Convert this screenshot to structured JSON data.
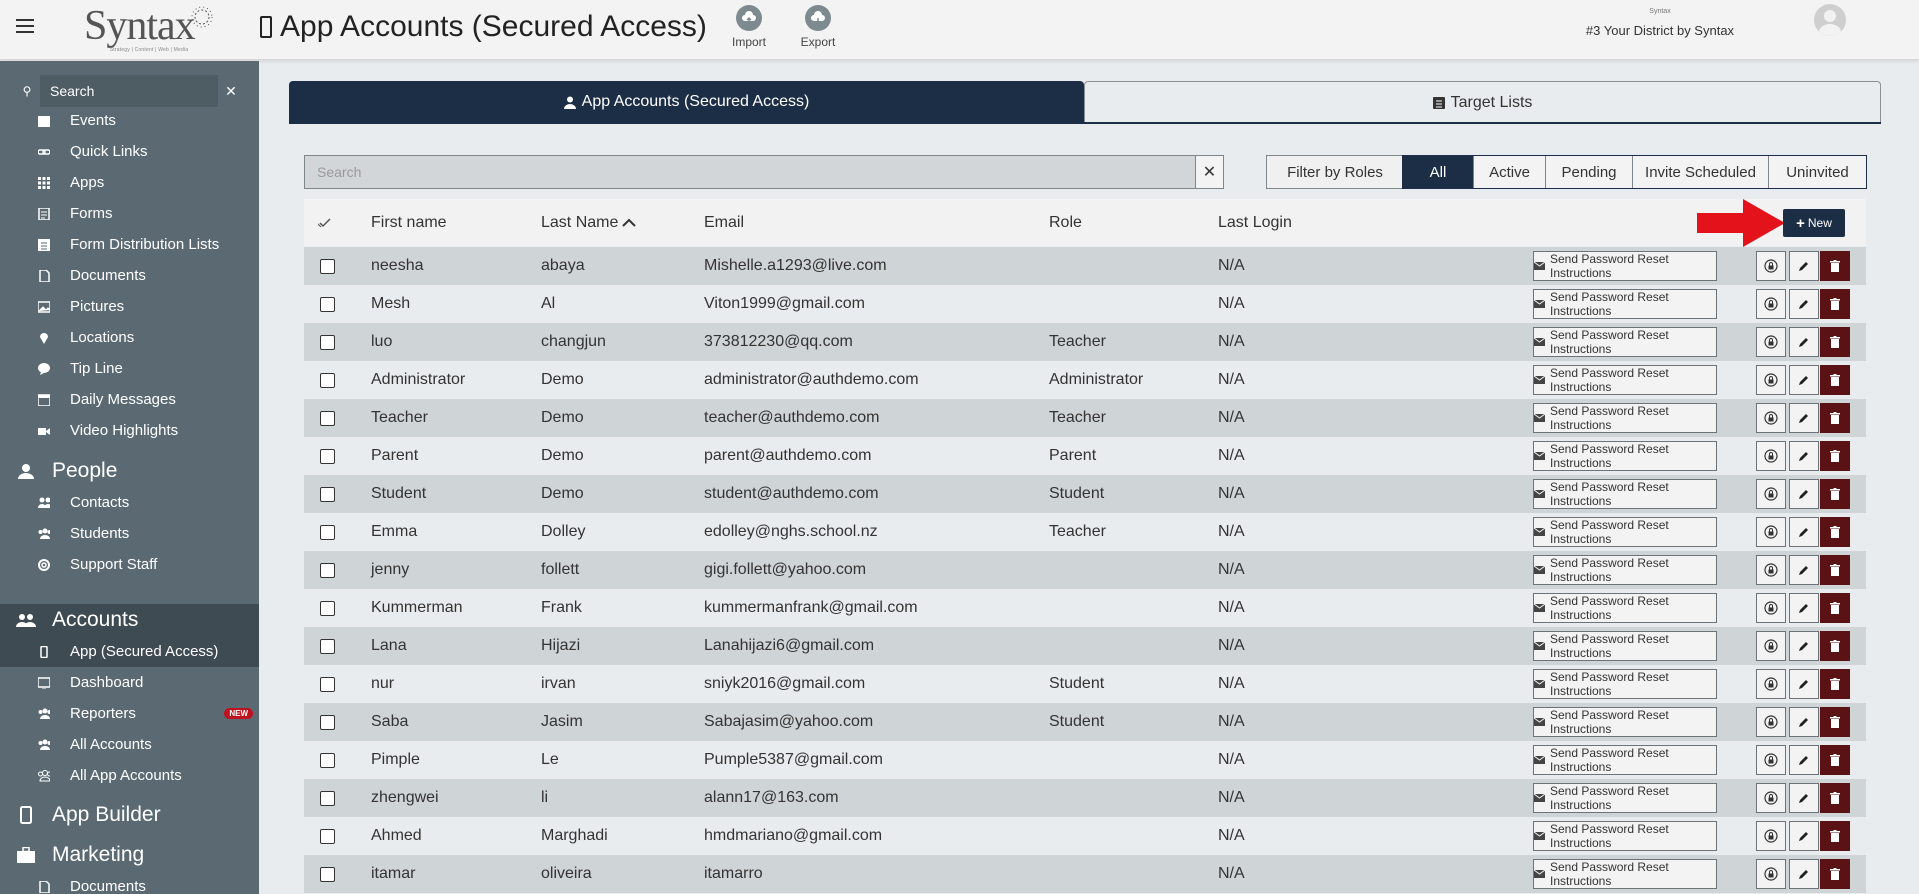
{
  "header": {
    "logo_text": "Syntax",
    "logo_tagline": "Strategy | Content | Web | Media",
    "page_title": "App Accounts (Secured Access)",
    "import_label": "Import",
    "export_label": "Export",
    "district_mini": "Syntax",
    "district_name": "#3 Your District by Syntax"
  },
  "sidebar": {
    "search_placeholder": "Search",
    "items_top": [
      {
        "label": "Events",
        "icon": "calendar-icon"
      },
      {
        "label": "Quick Links",
        "icon": "link-icon"
      },
      {
        "label": "Apps",
        "icon": "grid-icon"
      },
      {
        "label": "Forms",
        "icon": "form-icon"
      },
      {
        "label": "Form Distribution Lists",
        "icon": "list-icon"
      },
      {
        "label": "Documents",
        "icon": "document-icon"
      },
      {
        "label": "Pictures",
        "icon": "picture-icon"
      },
      {
        "label": "Locations",
        "icon": "pin-icon"
      },
      {
        "label": "Tip Line",
        "icon": "chat-icon"
      },
      {
        "label": "Daily Messages",
        "icon": "calendar-icon"
      },
      {
        "label": "Video Highlights",
        "icon": "video-icon"
      }
    ],
    "people": {
      "heading": "People",
      "items": [
        {
          "label": "Contacts",
          "icon": "contacts-icon"
        },
        {
          "label": "Students",
          "icon": "students-icon"
        },
        {
          "label": "Support Staff",
          "icon": "support-icon"
        }
      ]
    },
    "accounts": {
      "heading": "Accounts",
      "items": [
        {
          "label": "App (Secured Access)",
          "icon": "phone-icon"
        },
        {
          "label": "Dashboard",
          "icon": "monitor-icon"
        },
        {
          "label": "Reporters",
          "icon": "reporters-icon",
          "badge": "NEW"
        },
        {
          "label": "All Accounts",
          "icon": "group-icon"
        },
        {
          "label": "All App Accounts",
          "icon": "group-icon"
        }
      ]
    },
    "app_builder": {
      "heading": "App Builder"
    },
    "marketing": {
      "heading": "Marketing",
      "items": [
        {
          "label": "Documents",
          "icon": "document-icon"
        }
      ]
    }
  },
  "tabs": [
    {
      "label": "App Accounts (Secured Access)",
      "icon": "user-icon",
      "active": true
    },
    {
      "label": "Target Lists",
      "icon": "list-icon",
      "active": false
    }
  ],
  "toolbar": {
    "search_placeholder": "Search",
    "filter_label": "Filter by Roles",
    "segments": [
      {
        "label": "All",
        "active": true
      },
      {
        "label": "Active",
        "active": false
      },
      {
        "label": "Pending",
        "active": false
      },
      {
        "label": "Invite Scheduled",
        "active": false
      },
      {
        "label": "Uninvited",
        "active": false
      }
    ],
    "new_label": "New"
  },
  "table": {
    "headers": {
      "first_name": "First name",
      "last_name": "Last Name",
      "email": "Email",
      "role": "Role",
      "last_login": "Last Login"
    },
    "action_label": "Send Password Reset Instructions",
    "rows": [
      {
        "first": "neesha",
        "last": "abaya",
        "email": "Mishelle.a1293@live.com",
        "role": "",
        "login": "N/A"
      },
      {
        "first": "Mesh",
        "last": "Al",
        "email": "Viton1999@gmail.com",
        "role": "",
        "login": "N/A"
      },
      {
        "first": "luo",
        "last": "changjun",
        "email": "373812230@qq.com",
        "role": "Teacher",
        "login": "N/A"
      },
      {
        "first": "Administrator",
        "last": "Demo",
        "email": "administrator@authdemo.com",
        "role": "Administrator",
        "login": "N/A"
      },
      {
        "first": "Teacher",
        "last": "Demo",
        "email": "teacher@authdemo.com",
        "role": "Teacher",
        "login": "N/A"
      },
      {
        "first": "Parent",
        "last": "Demo",
        "email": "parent@authdemo.com",
        "role": "Parent",
        "login": "N/A"
      },
      {
        "first": "Student",
        "last": "Demo",
        "email": "student@authdemo.com",
        "role": "Student",
        "login": "N/A"
      },
      {
        "first": "Emma",
        "last": "Dolley",
        "email": "edolley@nghs.school.nz",
        "role": "Teacher",
        "login": "N/A"
      },
      {
        "first": "jenny",
        "last": "follett",
        "email": "gigi.follett@yahoo.com",
        "role": "",
        "login": "N/A"
      },
      {
        "first": "Kummerman",
        "last": "Frank",
        "email": "kummermanfrank@gmail.com",
        "role": "",
        "login": "N/A"
      },
      {
        "first": "Lana",
        "last": "Hijazi",
        "email": "Lanahijazi6@gmail.com",
        "role": "",
        "login": "N/A"
      },
      {
        "first": "nur",
        "last": "irvan",
        "email": "sniyk2016@gmail.com",
        "role": "Student",
        "login": "N/A"
      },
      {
        "first": "Saba",
        "last": "Jasim",
        "email": "Sabajasim@yahoo.com",
        "role": "Student",
        "login": "N/A"
      },
      {
        "first": "Pimple",
        "last": "Le",
        "email": "Pumple5387@gmail.com",
        "role": "",
        "login": "N/A"
      },
      {
        "first": "zhengwei",
        "last": "li",
        "email": "alann17@163.com",
        "role": "",
        "login": "N/A"
      },
      {
        "first": "Ahmed",
        "last": "Marghadi",
        "email": "hmdmariano@gmail.com",
        "role": "",
        "login": "N/A"
      },
      {
        "first": "itamar",
        "last": "oliveira",
        "email": "itamarro",
        "role": "",
        "login": "N/A"
      }
    ]
  },
  "colors": {
    "navy": "#1c2e45",
    "sidebar": "#5b6a72",
    "delete": "#5b1215",
    "arrow": "#e4131b"
  }
}
